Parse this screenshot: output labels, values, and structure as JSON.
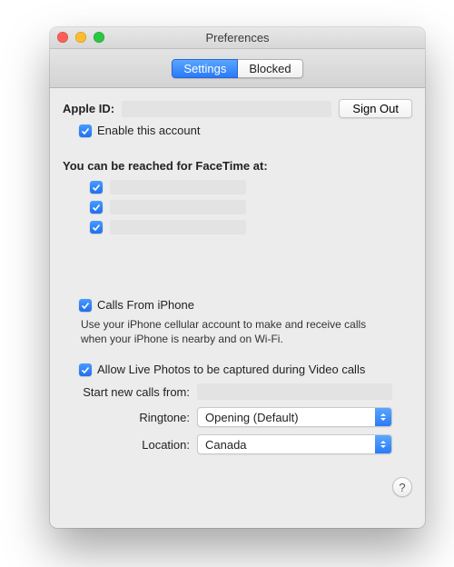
{
  "window": {
    "title": "Preferences"
  },
  "tabs": {
    "settings": "Settings",
    "blocked": "Blocked",
    "active": "settings"
  },
  "apple_id": {
    "label": "Apple ID:",
    "value": ""
  },
  "sign_out": "Sign Out",
  "enable_account": {
    "checked": true,
    "label": "Enable this account"
  },
  "reach": {
    "heading": "You can be reached for FaceTime at:",
    "items": [
      {
        "checked": true,
        "label": ""
      },
      {
        "checked": true,
        "label": ""
      },
      {
        "checked": true,
        "label": ""
      }
    ]
  },
  "calls_from_iphone": {
    "checked": true,
    "label": "Calls From iPhone",
    "desc": "Use your iPhone cellular account to make and receive calls when your iPhone is nearby and on Wi-Fi."
  },
  "live_photos": {
    "checked": true,
    "label": "Allow Live Photos to be captured during Video calls"
  },
  "start_calls": {
    "label": "Start new calls from:",
    "value": ""
  },
  "ringtone": {
    "label": "Ringtone:",
    "value": "Opening (Default)"
  },
  "location": {
    "label": "Location:",
    "value": "Canada"
  },
  "help": "?"
}
